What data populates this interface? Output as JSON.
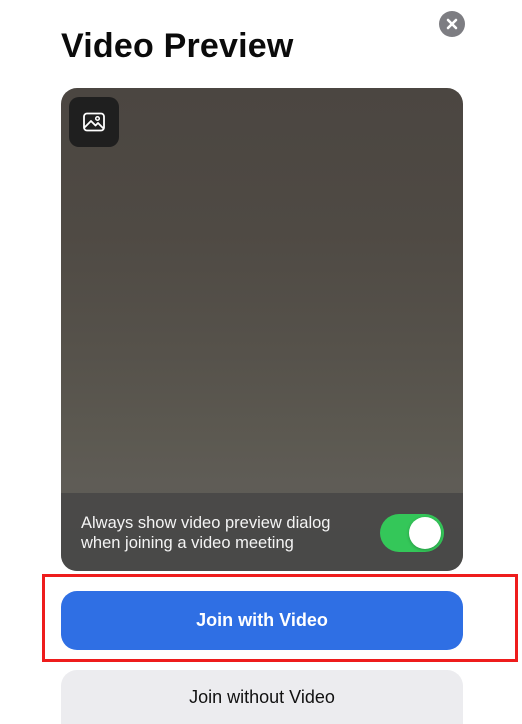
{
  "header": {
    "title": "Video Preview",
    "close_icon": "close-icon"
  },
  "preview": {
    "gallery_icon": "image-icon",
    "toggle": {
      "line1": "Always show video preview dialog",
      "line2": "when joining a video meeting",
      "on": true,
      "on_color": "#34c759"
    }
  },
  "actions": {
    "join_with_video": "Join with Video",
    "join_without_video": "Join without Video",
    "primary_color": "#2f6fe4",
    "highlight_color": "#ee1c1c"
  }
}
